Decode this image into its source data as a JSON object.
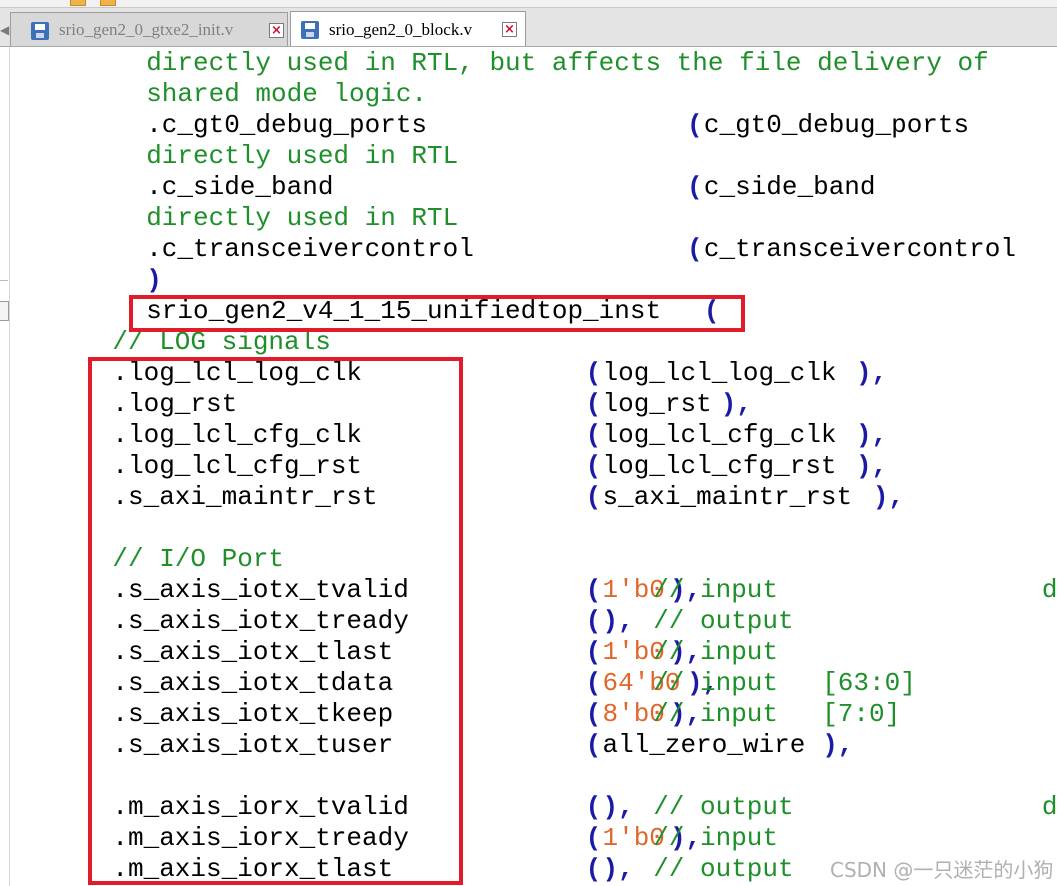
{
  "tabs": [
    {
      "label": "srio_gen2_0_gtxe2_init.v",
      "active": false
    },
    {
      "label": "srio_gen2_0_block.v",
      "active": true
    }
  ],
  "code_lines": [
    {
      "indent": 8,
      "text": "directly used in RTL, but affects the file delivery of",
      "kind": "comment-plain"
    },
    {
      "indent": 8,
      "text": "shared mode logic.",
      "kind": "comment-plain"
    },
    {
      "indent": 8,
      "port": ".c_gt0_debug_ports",
      "arg_open": "(",
      "arg": "c_gt0_debug_ports",
      "kind": "port-open"
    },
    {
      "indent": 8,
      "text": "directly used in RTL",
      "kind": "comment-plain"
    },
    {
      "indent": 8,
      "port": ".c_side_band",
      "arg_open": "(",
      "arg": "c_side_band",
      "kind": "port-open"
    },
    {
      "indent": 8,
      "text": "directly used in RTL",
      "kind": "comment-plain"
    },
    {
      "indent": 8,
      "port": ".c_transceivercontrol",
      "arg_open": "(",
      "arg": "c_transceivercontrol",
      "kind": "port-open"
    },
    {
      "indent": 8,
      "text": ")",
      "kind": "paren"
    },
    {
      "indent": 8,
      "text": "srio_gen2_v4_1_15_unifiedtop_inst",
      "paren": "(",
      "kind": "inst"
    },
    {
      "indent": 6,
      "text": "// LOG signals",
      "kind": "comment"
    },
    {
      "indent": 6,
      "port": ".log_lcl_log_clk",
      "arg": "log_lcl_log_clk",
      "kind": "port"
    },
    {
      "indent": 6,
      "port": ".log_rst",
      "arg": "log_rst",
      "kind": "port"
    },
    {
      "indent": 6,
      "port": ".log_lcl_cfg_clk",
      "arg": "log_lcl_cfg_clk",
      "kind": "port"
    },
    {
      "indent": 6,
      "port": ".log_lcl_cfg_rst",
      "arg": "log_lcl_cfg_rst",
      "kind": "port"
    },
    {
      "indent": 6,
      "port": ".s_axi_maintr_rst",
      "arg": "s_axi_maintr_rst",
      "kind": "port"
    },
    {
      "indent": 0,
      "text": "",
      "kind": "blank"
    },
    {
      "indent": 6,
      "text": "// I/O Port",
      "kind": "comment"
    },
    {
      "indent": 6,
      "port": ".s_axis_iotx_tvalid",
      "const": "1'b0",
      "comment": "// input",
      "tail": "de",
      "kind": "port-const"
    },
    {
      "indent": 6,
      "port": ".s_axis_iotx_tready",
      "empty": true,
      "comment": "// output",
      "kind": "port-const"
    },
    {
      "indent": 6,
      "port": ".s_axis_iotx_tlast",
      "const": "1'b0",
      "comment": "// input",
      "kind": "port-const"
    },
    {
      "indent": 6,
      "port": ".s_axis_iotx_tdata",
      "const": "64'b0",
      "comment": "// input",
      "range": "[63:0]",
      "kind": "port-const"
    },
    {
      "indent": 6,
      "port": ".s_axis_iotx_tkeep",
      "const": "8'b0",
      "comment": "// input",
      "range": "[7:0]",
      "kind": "port-const"
    },
    {
      "indent": 6,
      "port": ".s_axis_iotx_tuser",
      "arg": "all_zero_wire",
      "kind": "port"
    },
    {
      "indent": 0,
      "text": "",
      "kind": "blank"
    },
    {
      "indent": 6,
      "port": ".m_axis_iorx_tvalid",
      "empty": true,
      "comment": "// output",
      "tail": "de",
      "kind": "port-const"
    },
    {
      "indent": 6,
      "port": ".m_axis_iorx_tready",
      "const": "1'b0",
      "comment": "// input",
      "kind": "port-const"
    },
    {
      "indent": 6,
      "port": ".m_axis_iorx_tlast",
      "empty": true,
      "comment": "// output",
      "kind": "port-const"
    }
  ],
  "watermark": "CSDN @一只迷茫的小狗",
  "colors": {
    "comment": "#1f8f2a",
    "paren": "#1a1aa6",
    "number": "#e0672c",
    "highlight": "#e21b2a"
  }
}
